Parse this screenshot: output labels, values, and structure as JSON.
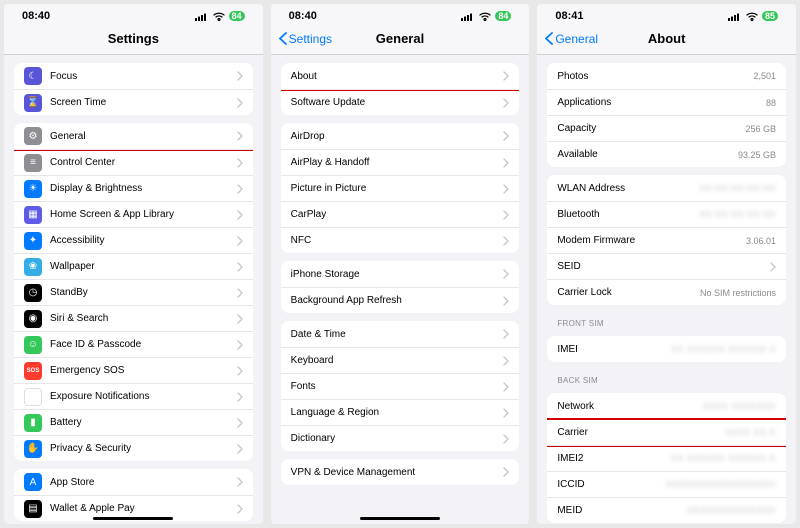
{
  "screens": {
    "settings": {
      "time": "08:40",
      "battery": "84",
      "title": "Settings",
      "rows1": [
        {
          "icon": "moon-icon",
          "bg": "bg-purple",
          "label": "Focus"
        },
        {
          "icon": "hourglass-icon",
          "bg": "bg-purple",
          "label": "Screen Time"
        }
      ],
      "rows2": [
        {
          "icon": "gear-icon",
          "bg": "bg-grey",
          "label": "General",
          "hl": true
        },
        {
          "icon": "switches-icon",
          "bg": "bg-grey",
          "label": "Control Center"
        },
        {
          "icon": "sun-icon",
          "bg": "bg-blue",
          "label": "Display & Brightness"
        },
        {
          "icon": "grid-icon",
          "bg": "bg-indigo",
          "label": "Home Screen & App Library"
        },
        {
          "icon": "person-icon",
          "bg": "bg-blue",
          "label": "Accessibility"
        },
        {
          "icon": "flower-icon",
          "bg": "bg-cyan",
          "label": "Wallpaper"
        },
        {
          "icon": "clock-icon",
          "bg": "bg-black",
          "label": "StandBy"
        },
        {
          "icon": "siri-icon",
          "bg": "bg-black",
          "label": "Siri & Search"
        },
        {
          "icon": "faceid-icon",
          "bg": "bg-green",
          "label": "Face ID & Passcode"
        },
        {
          "icon": "sos-icon",
          "bg": "bg-red",
          "label": "Emergency SOS"
        },
        {
          "icon": "virus-icon",
          "bg": "bg-white",
          "label": "Exposure Notifications"
        },
        {
          "icon": "battery-icon",
          "bg": "bg-green",
          "label": "Battery"
        },
        {
          "icon": "hand-icon",
          "bg": "bg-hand",
          "label": "Privacy & Security"
        }
      ],
      "rows3": [
        {
          "icon": "appstore-icon",
          "bg": "bg-appstore",
          "label": "App Store"
        },
        {
          "icon": "wallet-icon",
          "bg": "bg-black",
          "label": "Wallet & Apple Pay"
        }
      ]
    },
    "general": {
      "time": "08:40",
      "battery": "84",
      "back": "Settings",
      "title": "General",
      "g1": [
        {
          "label": "About",
          "hl": true
        },
        {
          "label": "Software Update"
        }
      ],
      "g2": [
        {
          "label": "AirDrop"
        },
        {
          "label": "AirPlay & Handoff"
        },
        {
          "label": "Picture in Picture"
        },
        {
          "label": "CarPlay"
        },
        {
          "label": "NFC"
        }
      ],
      "g3": [
        {
          "label": "iPhone Storage"
        },
        {
          "label": "Background App Refresh"
        }
      ],
      "g4": [
        {
          "label": "Date & Time"
        },
        {
          "label": "Keyboard"
        },
        {
          "label": "Fonts"
        },
        {
          "label": "Language & Region"
        },
        {
          "label": "Dictionary"
        }
      ],
      "g5": [
        {
          "label": "VPN & Device Management"
        }
      ]
    },
    "about": {
      "time": "08:41",
      "battery": "85",
      "back": "General",
      "title": "About",
      "g1": [
        {
          "label": "Photos",
          "value": "2,501"
        },
        {
          "label": "Applications",
          "value": "88"
        },
        {
          "label": "Capacity",
          "value": "256 GB"
        },
        {
          "label": "Available",
          "value": "93.25 GB"
        }
      ],
      "g2": [
        {
          "label": "WLAN Address",
          "blur": "XX:XX:XX:XX:XX"
        },
        {
          "label": "Bluetooth",
          "blur": "XX:XX:XX:XX:XX"
        },
        {
          "label": "Modem Firmware",
          "value": "3.06.01"
        },
        {
          "label": "SEID",
          "chev": true
        },
        {
          "label": "Carrier Lock",
          "value": "No SIM restrictions"
        }
      ],
      "h1": "FRONT SIM",
      "g3": [
        {
          "label": "IMEI",
          "blur": "XX XXXXXX XXXXXX X"
        }
      ],
      "h2": "BACK SIM",
      "g4": [
        {
          "label": "Network",
          "blur": "XXXX XXXXXXX"
        },
        {
          "label": "Carrier",
          "blur": "XXXX XX.X",
          "hl": true
        },
        {
          "label": "IMEI2",
          "blur": "XX XXXXXX XXXXXX X"
        },
        {
          "label": "ICCID",
          "blur": "XXXXXXXXXXXXXXXXXXX"
        },
        {
          "label": "MEID",
          "blur": "XXXXXXXXXXXXXX"
        }
      ]
    }
  }
}
